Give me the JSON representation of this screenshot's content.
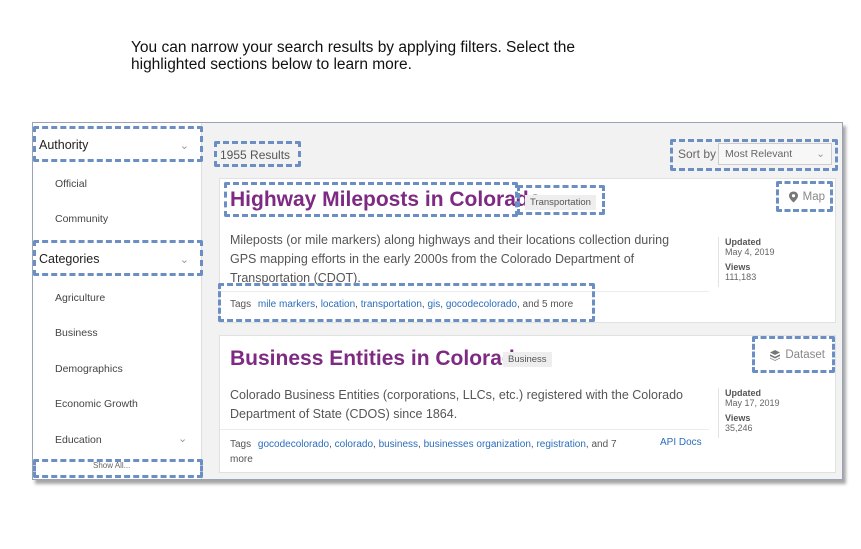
{
  "intro": {
    "line1": "You can narrow your search results by applying filters. Select the",
    "line2": "highlighted sections below to learn more."
  },
  "sidebar": {
    "authority": {
      "label": "Authority",
      "options": [
        "Official",
        "Community"
      ]
    },
    "categories": {
      "label": "Categories",
      "options": [
        "Agriculture",
        "Business",
        "Demographics",
        "Economic Growth",
        "Education"
      ]
    },
    "show_all": "Show All..."
  },
  "results": {
    "count": "1955 Results",
    "sort_label": "Sort by",
    "sort_value": "Most Relevant"
  },
  "cards": [
    {
      "title": "Highway Mileposts in Colorado",
      "category": "Transportation",
      "type": "Map",
      "type_icon": "map-pin-icon",
      "desc1": "Mileposts (or mile markers) along highways and their locations collection during",
      "desc2": "GPS mapping efforts in the early 2000s from the Colorado Department of",
      "desc3": "Transportation (CDOT).",
      "updated_label": "Updated",
      "updated": "May 4, 2019",
      "views_label": "Views",
      "views": "111,183",
      "tags_label": "Tags",
      "tags": [
        "mile markers",
        "location",
        "transportation",
        "gis",
        "gocodecolorado"
      ],
      "more": ", and 5 more"
    },
    {
      "title": "Business Entities in Colorado",
      "category": "Business",
      "type": "Dataset",
      "type_icon": "dataset-icon",
      "desc1": "Colorado Business Entities (corporations, LLCs, etc.) registered with the Colorado",
      "desc2": "Department of State (CDOS) since 1864.",
      "updated_label": "Updated",
      "updated": "May 17, 2019",
      "views_label": "Views",
      "views": "35,246",
      "tags_label": "Tags",
      "tags": [
        "gocodecolorado",
        "colorado",
        "business",
        "businesses organization",
        "registration"
      ],
      "more": ", and 7",
      "more2": "more",
      "api_docs": "API Docs"
    }
  ],
  "colors": {
    "title": "#7e2a82",
    "link": "#2a6ebb",
    "highlight": "#6b8ec3"
  }
}
